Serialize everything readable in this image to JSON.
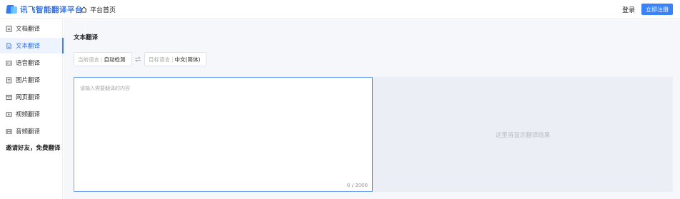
{
  "header": {
    "logo_text": "讯飞智能翻译平台",
    "home_link": "平台首页",
    "login": "登录",
    "register": "立即注册"
  },
  "sidebar": {
    "items": [
      {
        "label": "文档翻译",
        "icon": "document-icon",
        "active": false
      },
      {
        "label": "文本翻译",
        "icon": "text-file-icon",
        "active": true
      },
      {
        "label": "语音翻译",
        "icon": "voice-icon",
        "active": false
      },
      {
        "label": "图片翻译",
        "icon": "image-icon",
        "active": false
      },
      {
        "label": "网页翻译",
        "icon": "webpage-icon",
        "active": false
      },
      {
        "label": "视频翻译",
        "icon": "video-icon",
        "active": false
      },
      {
        "label": "音频翻译",
        "icon": "audio-icon",
        "active": false
      }
    ],
    "invite": "邀请好友，免费翻译"
  },
  "main": {
    "title": "文本翻译",
    "source_lang": {
      "label": "当前语言",
      "value": "自动检测"
    },
    "target_lang": {
      "label": "目标语言",
      "value": "中文(简体)"
    },
    "source_placeholder": "请输入需要翻译的内容",
    "char_count": "0 / 2000",
    "target_placeholder": "这里将显示翻译结果"
  },
  "colors": {
    "accent": "#3a82f7",
    "logo": "#2f6fe6",
    "active_bg": "#eef4ff",
    "target_bg": "#eceef5"
  }
}
